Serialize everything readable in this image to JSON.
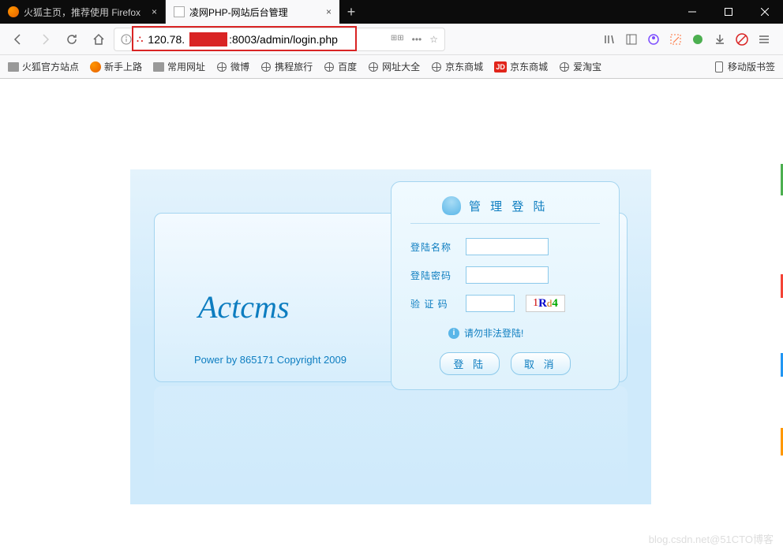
{
  "window": {
    "tab_inactive": "火狐主页，推荐使用 Firefox",
    "tab_active": "凌网PHP-网站后台管理",
    "close_x": "×",
    "plus": "+"
  },
  "url": {
    "prefix": "120.78.",
    "suffix": ":8003/admin/login.php",
    "dots": "•••"
  },
  "bookmarks": {
    "b1": "火狐官方站点",
    "b2": "新手上路",
    "b3": "常用网址",
    "b4": "微博",
    "b5": "携程旅行",
    "b6": "百度",
    "b7": "网址大全",
    "b8": "京东商城",
    "b9": "京东商城",
    "b10": "爱淘宝",
    "mobile": "移动版书签",
    "jd": "JD"
  },
  "login": {
    "brand": "Actcms",
    "copyright": "Power by 865171 Copyright 2009",
    "title": "管 理 登 陆",
    "label_name": "登陆名称",
    "label_pass": "登陆密码",
    "label_code": "验 证 码",
    "cap1": "1",
    "cap2": "R",
    "cap3": "d",
    "cap4": "4",
    "warning": "请勿非法登陆!",
    "btn_login": "登 陆",
    "btn_cancel": "取 消"
  },
  "watermark": "blog.csdn.net@51CTO博客"
}
